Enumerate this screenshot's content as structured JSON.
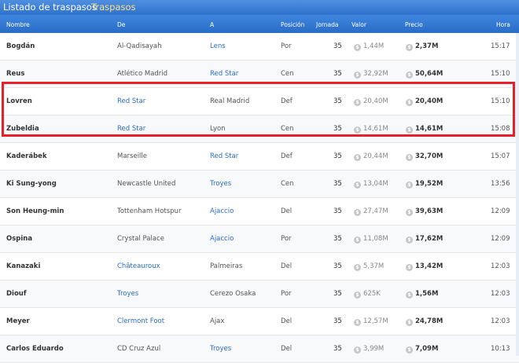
{
  "topbar": {
    "title": "Listado de traspasos",
    "tab": "Traspasos"
  },
  "columns": [
    "Nombre",
    "De",
    "A",
    "Posición",
    "Jornada",
    "Valor",
    "Precio",
    "Hora"
  ],
  "rows": [
    {
      "nombre": "Bogdán",
      "de": "Al-Qadisayah",
      "a": "Lens",
      "pos": "Por",
      "jornada": "35",
      "valor": "1,44M",
      "precio": "2,37M",
      "hora": "15:17",
      "de_link": false,
      "a_link": true
    },
    {
      "nombre": "Reus",
      "de": "Atlético Madrid",
      "a": "Red Star",
      "pos": "Cen",
      "jornada": "35",
      "valor": "32,92M",
      "precio": "50,64M",
      "hora": "15:10",
      "de_link": false,
      "a_link": true
    },
    {
      "nombre": "Lovren",
      "de": "Red Star",
      "a": "Real Madrid",
      "pos": "Def",
      "jornada": "35",
      "valor": "20,40M",
      "precio": "20,40M",
      "hora": "15:10",
      "de_link": true,
      "a_link": false
    },
    {
      "nombre": "Zubeldia",
      "de": "Red Star",
      "a": "Lyon",
      "pos": "Cen",
      "jornada": "35",
      "valor": "14,61M",
      "precio": "14,61M",
      "hora": "15:08",
      "de_link": true,
      "a_link": false
    },
    {
      "nombre": "Kaderábek",
      "de": "Marseille",
      "a": "Red Star",
      "pos": "Def",
      "jornada": "35",
      "valor": "20,44M",
      "precio": "32,70M",
      "hora": "15:07",
      "de_link": false,
      "a_link": true
    },
    {
      "nombre": "Ki Sung-yong",
      "de": "Newcastle United",
      "a": "Troyes",
      "pos": "Cen",
      "jornada": "35",
      "valor": "13,04M",
      "precio": "19,52M",
      "hora": "13:56",
      "de_link": false,
      "a_link": true
    },
    {
      "nombre": "Son Heung-min",
      "de": "Tottenham Hotspur",
      "a": "Ajaccio",
      "pos": "Del",
      "jornada": "35",
      "valor": "27,47M",
      "precio": "39,63M",
      "hora": "12:09",
      "de_link": false,
      "a_link": true
    },
    {
      "nombre": "Ospina",
      "de": "Crystal Palace",
      "a": "Ajaccio",
      "pos": "Por",
      "jornada": "35",
      "valor": "11,08M",
      "precio": "17,62M",
      "hora": "12:09",
      "de_link": false,
      "a_link": true
    },
    {
      "nombre": "Kanazaki",
      "de": "Châteauroux",
      "a": "Palmeiras",
      "pos": "Del",
      "jornada": "35",
      "valor": "5,37M",
      "precio": "13,42M",
      "hora": "12:03",
      "de_link": true,
      "a_link": false
    },
    {
      "nombre": "Diouf",
      "de": "Troyes",
      "a": "Cerezo Osaka",
      "pos": "Por",
      "jornada": "35",
      "valor": "625K",
      "precio": "1,56M",
      "hora": "12:03",
      "de_link": true,
      "a_link": false
    },
    {
      "nombre": "Meyer",
      "de": "Clermont Foot",
      "a": "Ajax",
      "pos": "Del",
      "jornada": "35",
      "valor": "12,57M",
      "precio": "24,78M",
      "hora": "12:03",
      "de_link": true,
      "a_link": false
    },
    {
      "nombre": "Carlos Eduardo",
      "de": "CD Cruz Azul",
      "a": "Troyes",
      "pos": "Del",
      "jornada": "35",
      "valor": "3,99M",
      "precio": "7,09M",
      "hora": "10:13",
      "de_link": false,
      "a_link": true
    }
  ],
  "coin_symbol": "$",
  "colors": {
    "header": "#2f72cc",
    "link": "#2a6cc7",
    "highlight": "#e8202a",
    "tab": "#ffe082"
  }
}
